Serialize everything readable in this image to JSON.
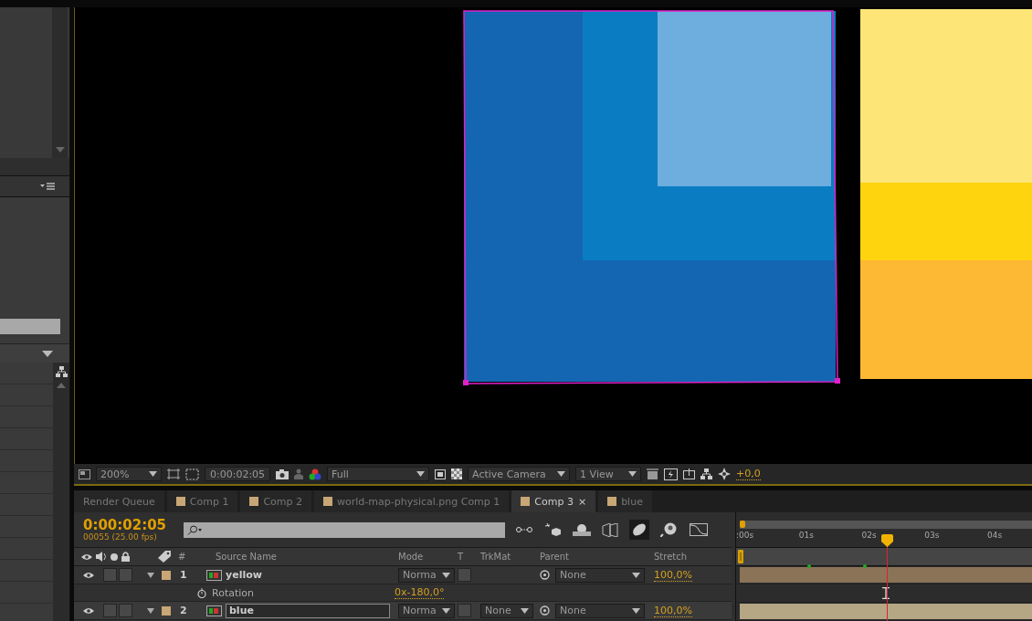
{
  "viewer": {
    "zoom": "200%",
    "timecode": "0:00:02:05",
    "resolution": "Full",
    "camera": "Active Camera",
    "views": "1 View",
    "exposure": "+0,0"
  },
  "tabs": [
    {
      "label": "Render Queue",
      "kind": "queue",
      "selected": false
    },
    {
      "label": "Comp 1",
      "kind": "comp",
      "selected": false
    },
    {
      "label": "Comp 2",
      "kind": "comp",
      "selected": false
    },
    {
      "label": "world-map-physical.png Comp 1",
      "kind": "comp",
      "selected": false
    },
    {
      "label": "Comp 3",
      "kind": "comp",
      "selected": true,
      "close": "×"
    },
    {
      "label": "blue",
      "kind": "comp",
      "selected": false
    }
  ],
  "timeline": {
    "timecode": "0:00:02:05",
    "frames": "00055 (25.00 fps)",
    "columns": [
      "#",
      "Source Name",
      "Mode",
      "T",
      "TrkMat",
      "Parent",
      "Stretch"
    ],
    "ruler": [
      ":00s",
      "01s",
      "02s",
      "03s",
      "04s"
    ],
    "playhead": {
      "level": 0.51
    },
    "layers": [
      {
        "number": "1",
        "name": "yellow",
        "mode": "Norma",
        "parent": "None",
        "stretch": "100,0%",
        "selected": false,
        "editing": false,
        "properties": [
          {
            "name": "Rotation",
            "value": "0x-180,0°"
          }
        ]
      },
      {
        "number": "2",
        "name": "blue",
        "mode": "Norma",
        "trkmat": "None",
        "parent": "None",
        "stretch": "100,0%",
        "selected": true,
        "editing": true
      }
    ]
  }
}
